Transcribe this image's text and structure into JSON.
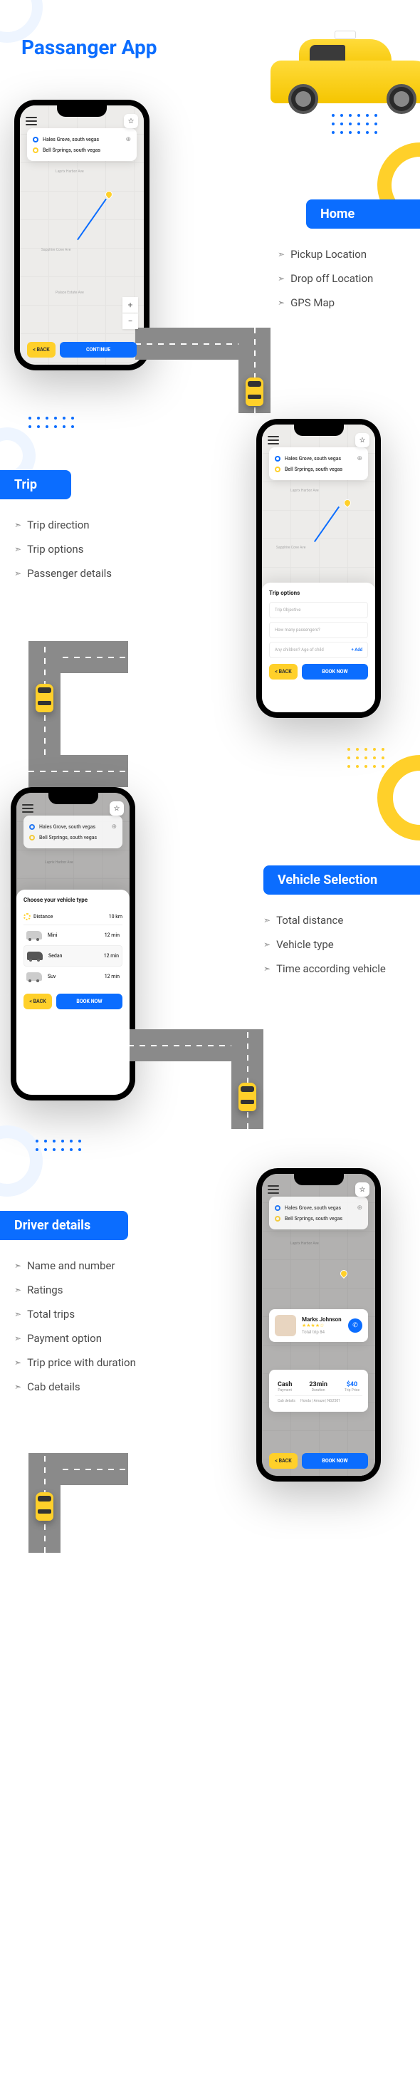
{
  "title": "Passanger App",
  "pickup": "Hales Grove, south vegas",
  "dropoff": "Bell Srprings, south vegas",
  "streets": {
    "laprix": "Laprix Harbor Ave",
    "sapphire": "Sapphire Cove Ave",
    "palace": "Palace Estate Ave"
  },
  "home": {
    "tag": "Home",
    "features": [
      "Pickup Location",
      "Drop off Location",
      "GPS Map"
    ],
    "back": "< BACK",
    "continue": "CONTINUE"
  },
  "trip": {
    "tag": "Trip",
    "features": [
      "Trip direction",
      "Trip options",
      "Passenger details"
    ],
    "panel_title": "Trip options",
    "objective": "Trip Objective",
    "passengers": "How many passengers?",
    "children": "Any children? Age of child",
    "add": "+ Add",
    "back": "< BACK",
    "book": "BOOK NOW"
  },
  "vehicle": {
    "tag": "Vehicle Selection",
    "features": [
      "Total distance",
      "Vehicle type",
      "Time according vehicle"
    ],
    "panel_title": "Choose your vehicle type",
    "distance_label": "Distance",
    "distance_val": "10 km",
    "vehicles": [
      {
        "name": "Mini",
        "time": "12 min"
      },
      {
        "name": "Sedan",
        "time": "12 min"
      },
      {
        "name": "Suv",
        "time": "12 min"
      }
    ],
    "back": "< BACK",
    "book": "BOOK NOW"
  },
  "driver": {
    "tag": "Driver details",
    "features": [
      "Name and number",
      "Ratings",
      "Total trips",
      "Payment option",
      "Trip price with duration",
      "Cab details"
    ],
    "name": "Marks Johnson",
    "stars": "★★★★☆",
    "trips": "Total trip 84",
    "payment_val": "Cash",
    "payment_lbl": "Payment",
    "duration_val": "23min",
    "duration_lbl": "Duration",
    "price_val": "$40",
    "price_lbl": "Trip Price",
    "cab_label": "Cab details",
    "cab_brand": "Honda",
    "cab_model": "Amaze",
    "cab_plate": "NG2501",
    "back": "< BACK",
    "book": "BOOK NOW"
  }
}
